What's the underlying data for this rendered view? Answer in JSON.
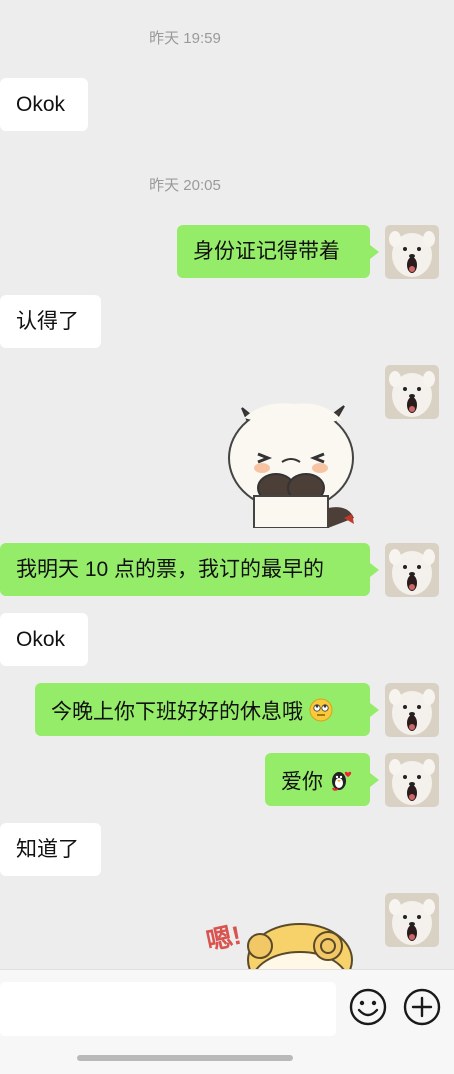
{
  "messages": {
    "time1": "昨天 19:59",
    "msg1": "Okok",
    "time2": "昨天 20:05",
    "msg2": "身份证记得带着",
    "msg3": "认得了",
    "msg4": "我明天 10 点的票，我订的最早的",
    "msg5": "Okok",
    "msg6": "今晚上你下班好好的休息哦",
    "msg7": "爱你",
    "msg8": "知道了",
    "sticker_text": "嗯!"
  },
  "icons": {
    "avatar": "dog-avatar",
    "emoji_eyeroll": "eye-roll-emoji",
    "emoji_love": "penguin-love-emoji",
    "emoji_button": "smiley-icon",
    "add_button": "plus-circle-icon"
  },
  "colors": {
    "background": "#ededed",
    "bubble_self": "#95ec69",
    "bubble_other": "#ffffff"
  }
}
